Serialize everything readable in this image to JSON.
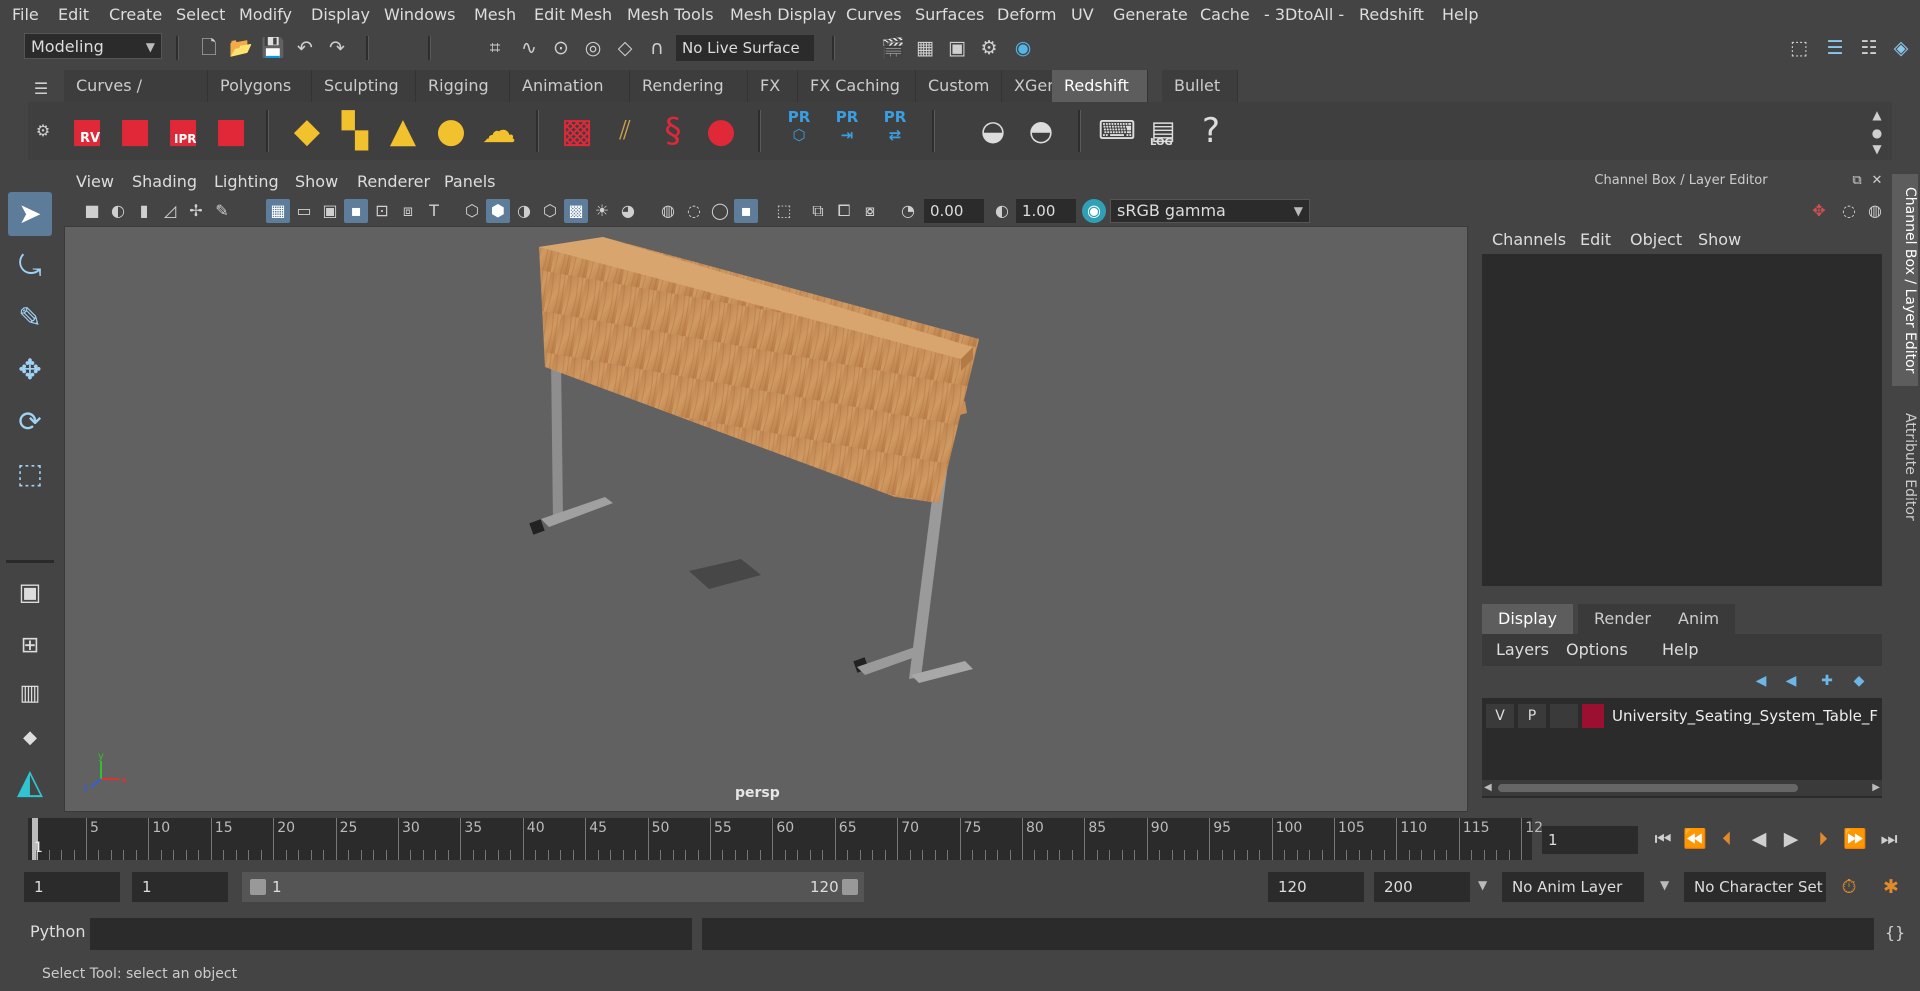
{
  "menubar": {
    "items": [
      "File",
      "Edit",
      "Create",
      "Select",
      "Modify",
      "Display",
      "Windows",
      "Mesh",
      "Edit Mesh",
      "Mesh Tools",
      "Mesh Display",
      "Curves",
      "Surfaces",
      "Deform",
      "UV",
      "Generate",
      "Cache",
      "- 3DtoAll -",
      "Redshift",
      "Help"
    ]
  },
  "statusline": {
    "mode": "Modeling",
    "live_surface": "No Live Surface"
  },
  "shelf": {
    "tabs": [
      "Curves / Surfaces",
      "Polygons",
      "Sculpting",
      "Rigging",
      "Animation",
      "Rendering",
      "FX",
      "FX Caching",
      "Custom",
      "XGen",
      "Redshift",
      "Bullet"
    ],
    "active_tab": "Redshift",
    "icon_labels": {
      "rv": "RV",
      "ipr": "IPR",
      "pr": "PR",
      "log": "LOG",
      "help": "?"
    }
  },
  "viewport": {
    "menu": [
      "View",
      "Shading",
      "Lighting",
      "Show",
      "Renderer",
      "Panels"
    ],
    "exposure": "0.00",
    "gamma": "1.00",
    "color_space": "sRGB gamma",
    "camera_label": "persp",
    "axis_labels": {
      "x": "x",
      "y": "y",
      "z": "z"
    }
  },
  "channel_box": {
    "title": "Channel Box / Layer Editor",
    "menu": [
      "Channels",
      "Edit",
      "Object",
      "Show"
    ],
    "layer_tabs": [
      "Display",
      "Render",
      "Anim"
    ],
    "active_layer_tab": "Display",
    "layer_menu": [
      "Layers",
      "Options",
      "Help"
    ],
    "layer": {
      "visible": "V",
      "playback": "P",
      "name": "University_Seating_System_Table_For",
      "color": "#9b1030"
    }
  },
  "side_tabs": [
    "Channel Box / Layer Editor",
    "Attribute Editor"
  ],
  "timeline": {
    "ticks": [
      "5",
      "10",
      "15",
      "20",
      "25",
      "30",
      "35",
      "40",
      "45",
      "50",
      "55",
      "60",
      "65",
      "70",
      "75",
      "80",
      "85",
      "90",
      "95",
      "100",
      "105",
      "110",
      "115",
      "12"
    ],
    "current_marker": "1",
    "current_frame": "1"
  },
  "range": {
    "start": "1",
    "playback_start": "1",
    "slider_start": "1",
    "slider_end": "120",
    "playback_end": "120",
    "end": "200",
    "anim_layer": "No Anim Layer",
    "character_set": "No Character Set"
  },
  "command_line": {
    "language": "Python"
  },
  "help_line": {
    "text": "Select Tool: select an object"
  },
  "colors": {
    "ui_bg": "#444444",
    "field_bg": "#2b2b2b",
    "viewport_bg": "#616161",
    "accent_blue": "#5c7c99",
    "wood": "#c8905a"
  }
}
